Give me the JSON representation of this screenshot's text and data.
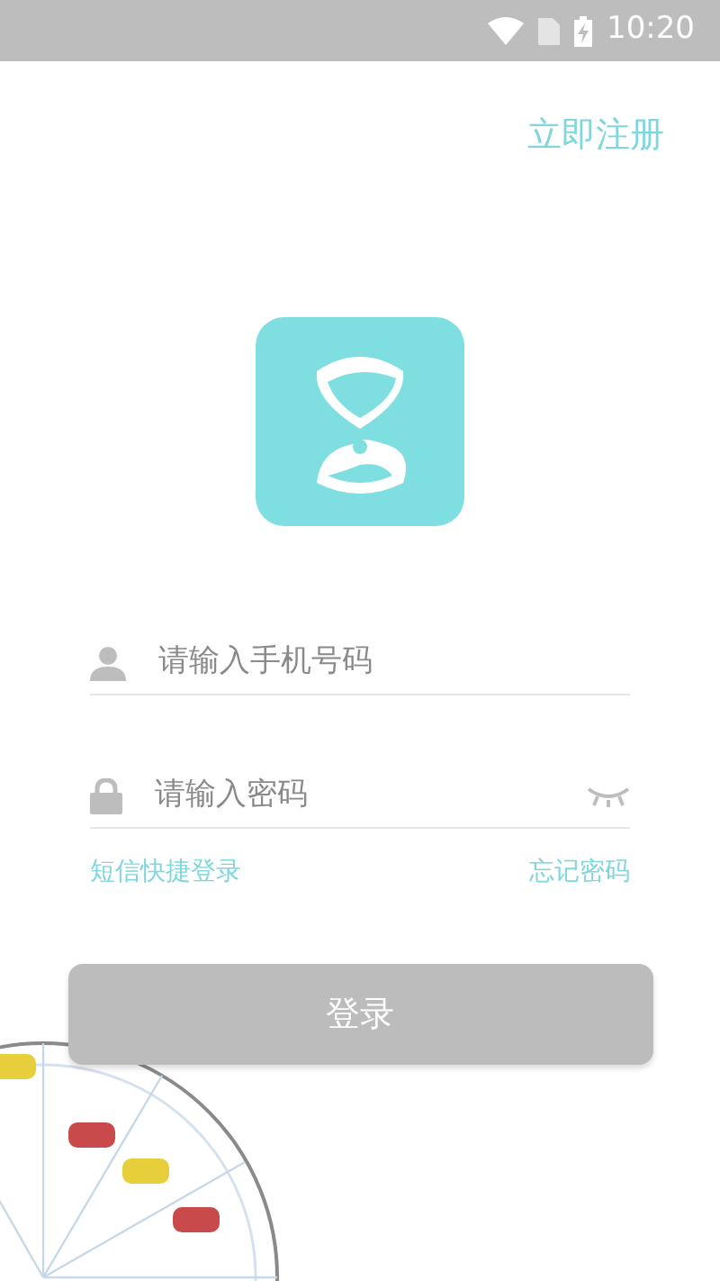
{
  "status_bar": {
    "time": "10:20"
  },
  "register_link": "立即注册",
  "phone_field": {
    "placeholder": "请输入手机号码"
  },
  "password_field": {
    "placeholder": "请输入密码",
    "password_visible": false
  },
  "sms_login_link": "短信快捷登录",
  "forgot_password_link": "忘记密码",
  "login_button": {
    "label": "登录",
    "disabled": true
  }
}
